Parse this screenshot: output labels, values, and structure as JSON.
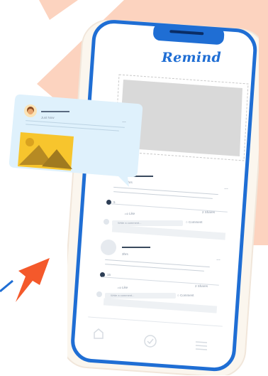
{
  "app": {
    "brand": "Remind"
  },
  "popup": {
    "meta": "Just Now"
  },
  "post1": {
    "meta": "5hrs",
    "reaction_count": "5",
    "like_label": "Like",
    "share_meta": "2 Shares",
    "comment_label": "Comment",
    "comment_placeholder": "Write a comment..."
  },
  "post2": {
    "meta": "3hrs",
    "reaction_count": "15",
    "like_label": "Like",
    "share_meta": "2 Shares",
    "comment_label": "Comment",
    "comment_placeholder": "Write a comment..."
  },
  "colors": {
    "phone_frame": "#1f6ed4",
    "peach": "#fcd3bf",
    "arrow": "#f4592b",
    "bubble": "#dff1fc",
    "image_yellow": "#f7c52d"
  },
  "icons": [
    "home-icon",
    "check-circle-icon",
    "menu-icon",
    "like-icon",
    "comment-icon",
    "share-icon",
    "avatar-icon",
    "image-icon"
  ]
}
